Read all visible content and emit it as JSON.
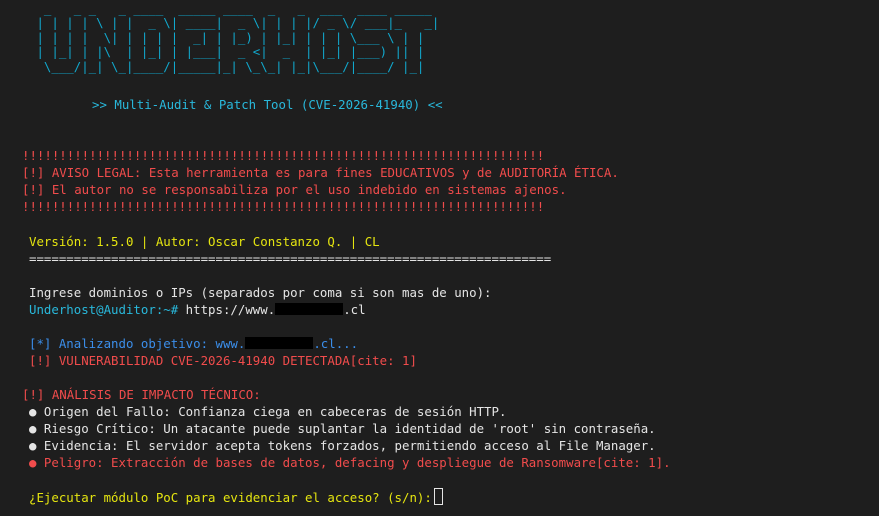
{
  "banner": {
    "ascii": [
      "  _   _ _   _ ____  _____ ____  _   _  ___  ____ _____ ",
      " | | | | \\ | |  _ \\| ____|  _ \\| | | |/ _ \\/ ___|_   _|",
      " | | | |  \\| | | | |  _| | |_) | |_| | | | \\___ \\ | |  ",
      " | |_| | |\\  | |_| | |___|  _ <|  _  | |_| |___) || |  ",
      "  \\___/|_| \\_|____/|_____|_| \\_\\_| |_|\\___/|____/ |_|  "
    ],
    "subtitle": ">> Multi-Audit & Patch Tool (CVE-2026-41940) <<"
  },
  "legal": {
    "border_top": "!!!!!!!!!!!!!!!!!!!!!!!!!!!!!!!!!!!!!!!!!!!!!!!!!!!!!!!!!!!!!!!!!!!!!!",
    "line1": "[!] AVISO LEGAL: Esta herramienta es para fines EDUCATIVOS y de AUDITORÍA ÉTICA.",
    "line2": "[!] El autor no se responsabiliza por el uso indebido en sistemas ajenos.",
    "border_bottom": "!!!!!!!!!!!!!!!!!!!!!!!!!!!!!!!!!!!!!!!!!!!!!!!!!!!!!!!!!!!!!!!!!!!!!!"
  },
  "info": {
    "version_line": "Versión: 1.5.0 | Autor: Oscar Constanzo Q. | CL",
    "separator": "======================================================================"
  },
  "input": {
    "prompt_text": "Ingrese dominios o IPs (separados por coma si son mas de uno):",
    "shell_prompt": "Underhost@Auditor:~#",
    "typed_prefix": " https://www.",
    "typed_suffix": ".cl"
  },
  "scan": {
    "analyzing_prefix": "[*] Analizando objetivo: www.",
    "analyzing_suffix": ".cl...",
    "vuln_detected": "[!] VULNERABILIDAD CVE-2026-41940 DETECTADA[cite: 1]"
  },
  "impact": {
    "header": "[!] ANÁLISIS DE IMPACTO TÉCNICO:",
    "items": [
      "● Origen del Fallo: Confianza ciega en cabeceras de sesión HTTP.",
      "● Riesgo Crítico: Un atacante puede suplantar la identidad de 'root' sin contraseña.",
      "● Evidencia: El servidor acepta tokens forzados, permitiendo acceso al File Manager.",
      "● Peligro: Extracción de bases de datos, defacing y despliegue de Ransomware[cite: 1]."
    ]
  },
  "confirm": {
    "question": "¿Ejecutar módulo PoC para evidenciar el acceso? (s/n):"
  }
}
